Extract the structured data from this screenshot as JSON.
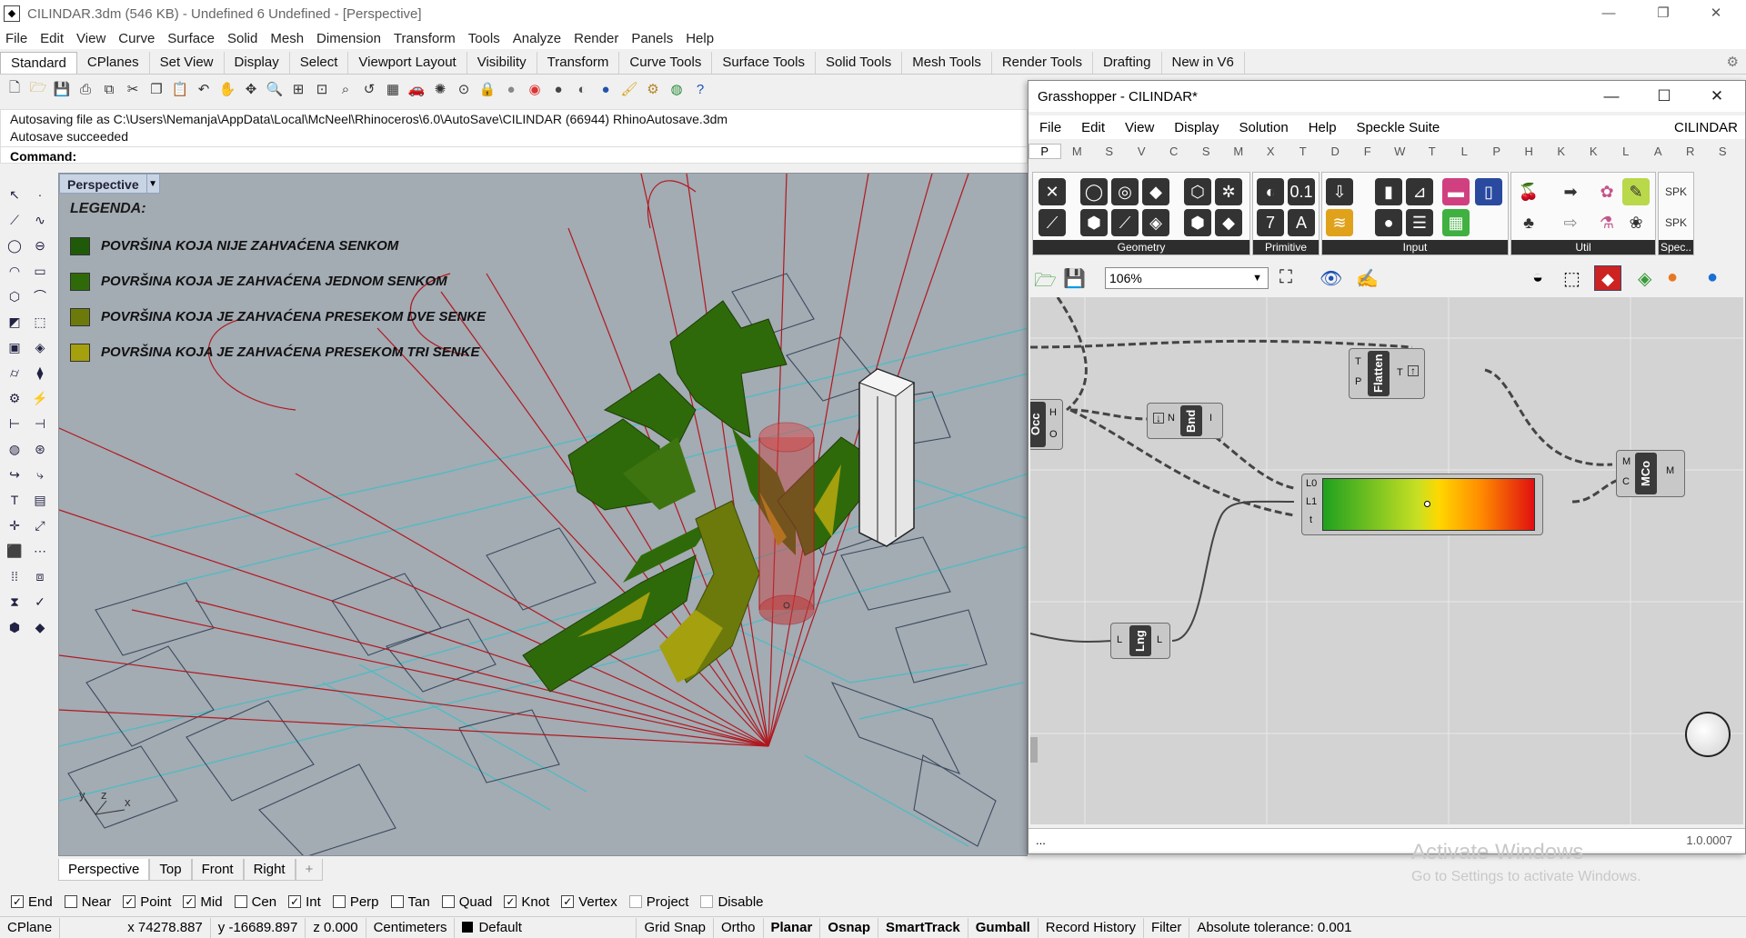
{
  "window": {
    "title": "CILINDAR.3dm (546 KB) - Undefined 6 Undefined - [Perspective]",
    "minimize": "—",
    "restore": "❐",
    "close": "✕"
  },
  "menu": [
    "File",
    "Edit",
    "View",
    "Curve",
    "Surface",
    "Solid",
    "Mesh",
    "Dimension",
    "Transform",
    "Tools",
    "Analyze",
    "Render",
    "Panels",
    "Help"
  ],
  "toolbar_tabs": [
    "Standard",
    "CPlanes",
    "Set View",
    "Display",
    "Select",
    "Viewport Layout",
    "Visibility",
    "Transform",
    "Curve Tools",
    "Surface Tools",
    "Solid Tools",
    "Mesh Tools",
    "Render Tools",
    "Drafting",
    "New in V6"
  ],
  "toolbar_icons": [
    "new-file",
    "open-file",
    "save",
    "print",
    "import",
    "cut",
    "copy",
    "paste",
    "undo",
    "pan",
    "rotate",
    "zoom-window",
    "zoom-extents",
    "zoom-selected",
    "zoom-all",
    "undo-view",
    "grid",
    "car",
    "light",
    "point",
    "lock",
    "sphere",
    "rainbow",
    "material",
    "shade",
    "render",
    "paint",
    "gear",
    "globe",
    "help"
  ],
  "command": {
    "line1": "Autosaving file as C:\\Users\\Nemanja\\AppData\\Local\\McNeel\\Rhinoceros\\6.0\\AutoSave\\CILINDAR (66944) RhinoAutosave.3dm",
    "line2": "Autosave succeeded",
    "prompt": "Command:"
  },
  "viewport": {
    "name": "Perspective",
    "legend_title": "LEGENDA:",
    "legend": [
      {
        "label": "POVRŠINA KOJA NIJE ZAHVAĆENA SENKOM",
        "color": "#1f5a08"
      },
      {
        "label": "POVRŠINA KOJA JE ZAHVAĆENA JEDNOM SENKOM",
        "color": "#2f6a0a"
      },
      {
        "label": "POVRŠINA KOJA JE ZAHVAĆENA PRESEKOM DVE SENKE",
        "color": "#6b7a0b"
      },
      {
        "label": "POVRŠINA KOJA JE ZAHVAĆENA PRESEKOM TRI SENKE",
        "color": "#a4a00e"
      }
    ],
    "axis_labels": {
      "y": "y",
      "z": "z",
      "x": "x"
    }
  },
  "viewport_tabs": [
    "Perspective",
    "Top",
    "Front",
    "Right",
    "+"
  ],
  "osnaps": [
    {
      "label": "End",
      "checked": true
    },
    {
      "label": "Near",
      "checked": false
    },
    {
      "label": "Point",
      "checked": true
    },
    {
      "label": "Mid",
      "checked": true
    },
    {
      "label": "Cen",
      "checked": false
    },
    {
      "label": "Int",
      "checked": true
    },
    {
      "label": "Perp",
      "checked": false
    },
    {
      "label": "Tan",
      "checked": false
    },
    {
      "label": "Quad",
      "checked": false
    },
    {
      "label": "Knot",
      "checked": true
    },
    {
      "label": "Vertex",
      "checked": true
    },
    {
      "label": "Project",
      "checked": false
    },
    {
      "label": "Disable",
      "checked": false
    }
  ],
  "status": {
    "cplane": "CPlane",
    "x": "x 74278.887",
    "y": "y -16689.897",
    "z": "z 0.000",
    "units": "Centimeters",
    "layer": "Default",
    "grid_snap": "Grid Snap",
    "ortho": "Ortho",
    "planar": "Planar",
    "osnap": "Osnap",
    "smarttrack": "SmartTrack",
    "gumball": "Gumball",
    "record_history": "Record History",
    "filter": "Filter",
    "tolerance": "Absolute tolerance: 0.001"
  },
  "grasshopper": {
    "title": "Grasshopper - CILINDAR*",
    "menu": [
      "File",
      "Edit",
      "View",
      "Display",
      "Solution",
      "Help",
      "Speckle Suite"
    ],
    "doc_name": "CILINDAR",
    "category_tabs": [
      "P",
      "M",
      "S",
      "V",
      "C",
      "S",
      "M",
      "X",
      "T",
      "D",
      "F",
      "W",
      "T",
      "L",
      "P",
      "H",
      "K",
      "K",
      "L",
      "A",
      "R",
      "S"
    ],
    "ribbon_groups": [
      "Geometry",
      "Primitive",
      "Input",
      "Util",
      "Spec.."
    ],
    "zoom": "106%",
    "nodes": {
      "flatten": {
        "name": "Flatten",
        "in1": "T",
        "in2": "P",
        "out": "T"
      },
      "occ": {
        "name": "Occ",
        "out1": "H",
        "out2": "O"
      },
      "bnd": {
        "name": "Bnd",
        "in": "N",
        "out": "I"
      },
      "gradient": {
        "in1": "L0",
        "in2": "L1",
        "in3": "t"
      },
      "mco": {
        "name": "MCo",
        "in1": "M",
        "in2": "C",
        "out": "M"
      },
      "lng": {
        "name": "Lng",
        "in": "L",
        "out": "L"
      }
    },
    "status_left": "...",
    "version": "1.0.0007"
  },
  "watermark": {
    "heading": "Activate Windows",
    "sub": "Go to Settings to activate Windows."
  }
}
